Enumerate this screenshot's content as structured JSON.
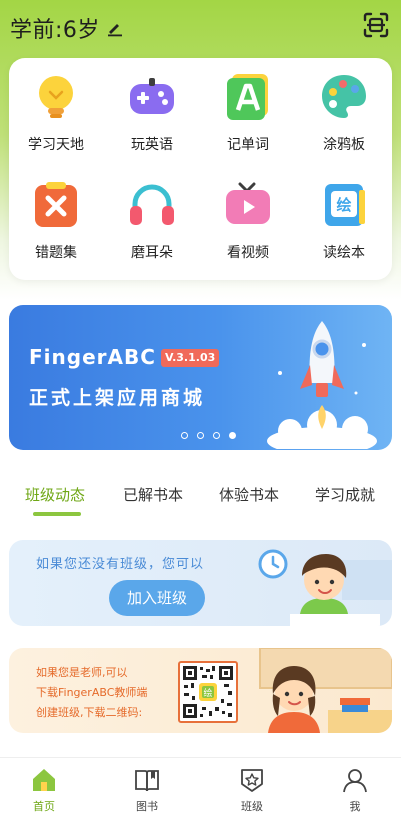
{
  "header": {
    "title": "学前:6岁"
  },
  "grid": [
    {
      "label": "学习天地",
      "icon": "lightbulb-icon"
    },
    {
      "label": "玩英语",
      "icon": "gamepad-icon"
    },
    {
      "label": "记单词",
      "icon": "letter-a-icon"
    },
    {
      "label": "涂鸦板",
      "icon": "palette-icon"
    },
    {
      "label": "错题集",
      "icon": "wrong-answers-icon"
    },
    {
      "label": "磨耳朵",
      "icon": "headphones-icon"
    },
    {
      "label": "看视频",
      "icon": "video-play-icon"
    },
    {
      "label": "读绘本",
      "icon": "picture-book-icon"
    }
  ],
  "banner": {
    "brand": "FingerABC",
    "version": "V.3.1.03",
    "slogan": "正式上架应用商城",
    "slide_count": 4,
    "active_slide": 4
  },
  "tabs": [
    {
      "label": "班级动态",
      "active": true
    },
    {
      "label": "已解书本",
      "active": false
    },
    {
      "label": "体验书本",
      "active": false
    },
    {
      "label": "学习成就",
      "active": false
    }
  ],
  "class_card": {
    "message": "如果您还没有班级，您可以",
    "button": "加入班级"
  },
  "teacher_card": {
    "line1": "如果您是老师,可以",
    "line2": "下载FingerABC教师端",
    "line3": "创建班级,下载二维码:",
    "qr_label": "绘"
  },
  "bottom_nav": [
    {
      "label": "首页",
      "icon": "home-icon",
      "active": true
    },
    {
      "label": "图书",
      "icon": "book-icon",
      "active": false
    },
    {
      "label": "班级",
      "icon": "class-badge-icon",
      "active": false
    },
    {
      "label": "我",
      "icon": "user-icon",
      "active": false
    }
  ],
  "colors": {
    "accent": "#8cc63f",
    "banner_blue": "#3a7be0",
    "orange": "#e56a2a"
  }
}
